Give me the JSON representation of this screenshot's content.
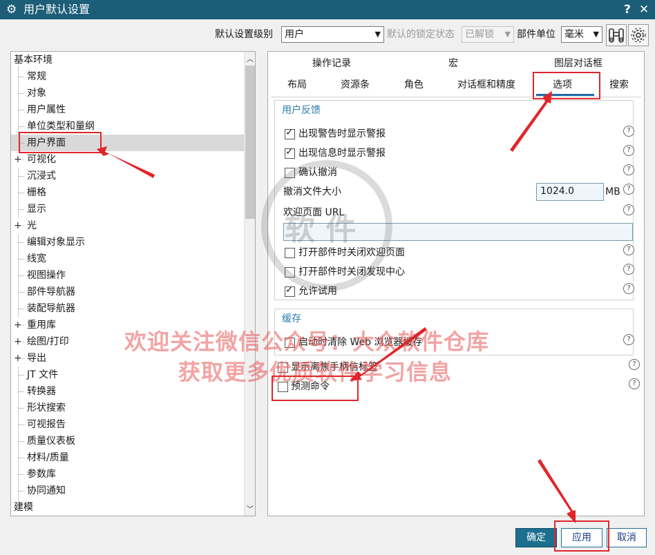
{
  "window": {
    "title": "用户默认设置",
    "help_glyph": "?",
    "close_glyph": "✕"
  },
  "toolbar": {
    "level_label": "默认设置级别",
    "level_value": "用户",
    "lock_label": "默认的锁定状态",
    "lock_value": "已解锁",
    "unit_label": "部件单位",
    "unit_value": "毫米"
  },
  "tree": {
    "items": [
      {
        "label": "基本环境",
        "indent": 0,
        "expander": ""
      },
      {
        "label": "常规",
        "indent": 1,
        "expander": ""
      },
      {
        "label": "对象",
        "indent": 1,
        "expander": ""
      },
      {
        "label": "用户属性",
        "indent": 1,
        "expander": ""
      },
      {
        "label": "单位类型和量纲",
        "indent": 1,
        "expander": ""
      },
      {
        "label": "用户界面",
        "indent": 1,
        "expander": "",
        "selected": true
      },
      {
        "label": "可视化",
        "indent": 1,
        "expander": "+"
      },
      {
        "label": "沉浸式",
        "indent": 1,
        "expander": ""
      },
      {
        "label": "栅格",
        "indent": 1,
        "expander": ""
      },
      {
        "label": "显示",
        "indent": 1,
        "expander": ""
      },
      {
        "label": "光",
        "indent": 1,
        "expander": "+"
      },
      {
        "label": "编辑对象显示",
        "indent": 1,
        "expander": ""
      },
      {
        "label": "线宽",
        "indent": 1,
        "expander": ""
      },
      {
        "label": "视图操作",
        "indent": 1,
        "expander": ""
      },
      {
        "label": "部件导航器",
        "indent": 1,
        "expander": ""
      },
      {
        "label": "装配导航器",
        "indent": 1,
        "expander": ""
      },
      {
        "label": "重用库",
        "indent": 1,
        "expander": "+"
      },
      {
        "label": "绘图/打印",
        "indent": 1,
        "expander": "+"
      },
      {
        "label": "导出",
        "indent": 1,
        "expander": "+"
      },
      {
        "label": "JT 文件",
        "indent": 1,
        "expander": ""
      },
      {
        "label": "转换器",
        "indent": 1,
        "expander": ""
      },
      {
        "label": "形状搜索",
        "indent": 1,
        "expander": ""
      },
      {
        "label": "可视报告",
        "indent": 1,
        "expander": ""
      },
      {
        "label": "质量仪表板",
        "indent": 1,
        "expander": ""
      },
      {
        "label": "材料/质量",
        "indent": 1,
        "expander": ""
      },
      {
        "label": "参数库",
        "indent": 1,
        "expander": ""
      },
      {
        "label": "协同通知",
        "indent": 1,
        "expander": ""
      },
      {
        "label": "建模",
        "indent": 0,
        "expander": ""
      }
    ]
  },
  "tabs": {
    "row1": [
      "操作记录",
      "宏",
      "图层对话框"
    ],
    "row2": [
      "布局",
      "资源条",
      "角色",
      "对话框和精度",
      "选项",
      "搜索"
    ],
    "active": "选项"
  },
  "feedback_group": {
    "title": "用户反馈",
    "warn_on_alert": {
      "label": "出现警告时显示警报",
      "checked": true
    },
    "warn_on_info": {
      "label": "出现信息时显示警报",
      "checked": true
    },
    "confirm_undo": {
      "label": "确认撤消",
      "checked": false
    },
    "undo_file_size_label": "撤消文件大小",
    "undo_file_size_value": "1024.0",
    "undo_file_size_unit": "MB",
    "welcome_url_label": "欢迎页面 URL",
    "welcome_url_value": "",
    "close_welcome": {
      "label": "打开部件时关闭欢迎页面",
      "checked": false
    },
    "close_discovery": {
      "label": "打开部件时关闭发现中心",
      "checked": false
    },
    "allow_trial": {
      "label": "允许试用",
      "checked": true
    }
  },
  "cache_group": {
    "title": "缓存",
    "clear_web_cache": {
      "label": "启动时清除 Web 浏览器缓存",
      "checked": false
    }
  },
  "extra_options": {
    "show_defocus_tooltip": {
      "label": "显示离焦手柄信标签",
      "checked": false
    },
    "predict_command": {
      "label": "预测命令",
      "checked": false
    }
  },
  "help_glyph": "?",
  "buttons": {
    "ok": "确定",
    "apply": "应用",
    "cancel": "取消"
  },
  "watermark": {
    "line1": "欢迎关注微信公众号：大众软件仓库",
    "line2": "获取更多优质软件学习信息",
    "stamp": "软 件"
  }
}
